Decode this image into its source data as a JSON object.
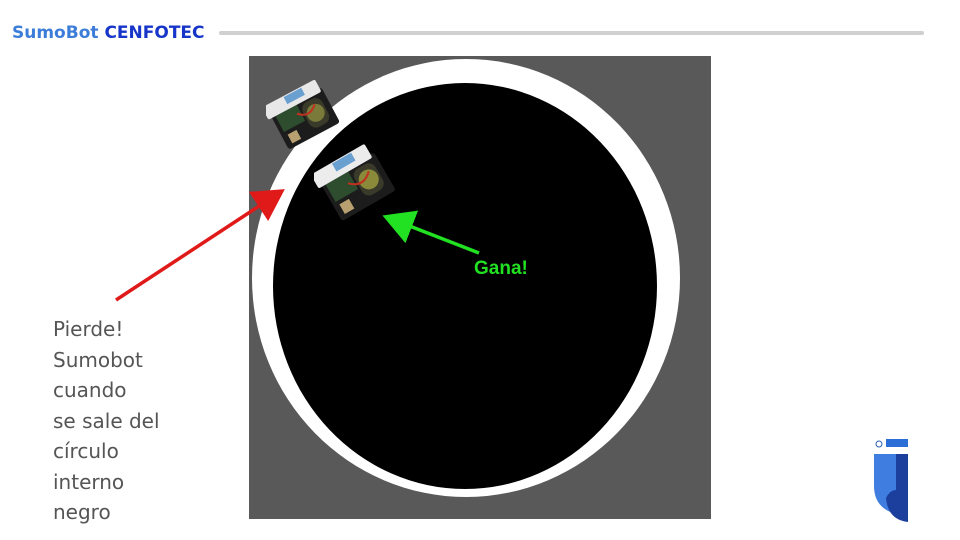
{
  "header": {
    "title_part1": "SumoBot",
    "title_part2": "CENFOTEC"
  },
  "labels": {
    "win": "Gana!",
    "lose_lines": [
      "Pierde!",
      "Sumobot",
      "cuando",
      "se sale del",
      "círculo",
      "interno",
      "negro"
    ]
  },
  "colors": {
    "win_arrow": "#22e022",
    "lose_arrow": "#e01919",
    "title_light": "#3b7dd8",
    "title_dark": "#1736c9",
    "arena_bg": "#595959",
    "ring": "#ffffff",
    "dohyo": "#000000"
  },
  "icons": {
    "logo": "cenfotec-logo-icon",
    "robot": "sumobot-robot-icon"
  }
}
